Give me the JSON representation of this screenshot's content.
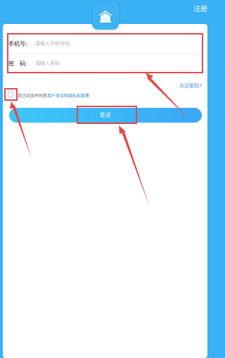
{
  "header": {
    "register_label": "注册"
  },
  "form": {
    "phone_label": "手机号:",
    "phone_placeholder": "请输入手机号码",
    "password_label": "密　码:",
    "password_placeholder": "请输入密码"
  },
  "forgot_password_label": "忘记密码?",
  "agreement": {
    "prefix": "我已阅读并同意",
    "user_agreement": "用户协议",
    "and": "和",
    "privacy_policy": "隐私权政策",
    "checked": false
  },
  "login_button_label": "登录",
  "icons": {
    "logo": "house-logo-icon",
    "checkbox": "checkbox-icon"
  },
  "colors": {
    "accent": "#3ab0f6",
    "link": "#2f86d6",
    "annotation": "#e34a4a"
  }
}
